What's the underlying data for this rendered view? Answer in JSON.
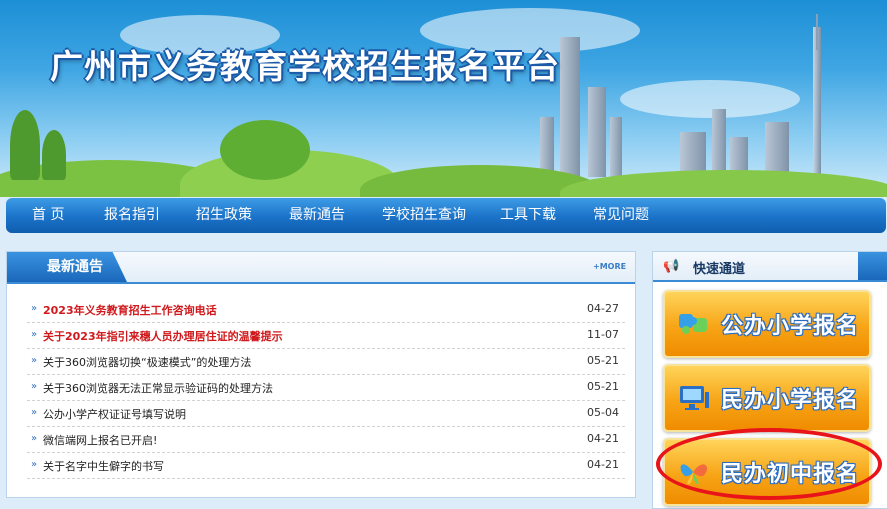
{
  "site": {
    "title": "广州市义务教育学校招生报名平台"
  },
  "nav": [
    {
      "label": "首 页"
    },
    {
      "label": "报名指引"
    },
    {
      "label": "招生政策"
    },
    {
      "label": "最新通告"
    },
    {
      "label": "学校招生查询"
    },
    {
      "label": "工具下载"
    },
    {
      "label": "常见问题"
    }
  ],
  "notices": {
    "title": "最新通告",
    "more": "+MORE",
    "items": [
      {
        "title": "2023年义务教育招生工作咨询电话",
        "date": "04-27",
        "highlight": true
      },
      {
        "title": "关于2023年指引来穗人员办理居住证的温馨提示",
        "date": "11-07",
        "highlight": true
      },
      {
        "title": "关于360浏览器切换“极速模式”的处理方法",
        "date": "05-21",
        "highlight": false
      },
      {
        "title": "关于360浏览器无法正常显示验证码的处理方法",
        "date": "05-21",
        "highlight": false
      },
      {
        "title": "公办小学产权证证号填写说明",
        "date": "05-04",
        "highlight": false
      },
      {
        "title": "微信端网上报名已开启!",
        "date": "04-21",
        "highlight": false
      },
      {
        "title": "关于名字中生僻字的书写",
        "date": "04-21",
        "highlight": false
      }
    ]
  },
  "quick": {
    "title": "快速通道",
    "buttons": [
      {
        "label": "公办小学报名",
        "icon": "puzzle-icon"
      },
      {
        "label": "民办小学报名",
        "icon": "computer-icon"
      },
      {
        "label": "民办初中报名",
        "icon": "butterfly-icon"
      }
    ]
  },
  "colors": {
    "nav": "#1b72c8",
    "hot": "#d0191c",
    "button": "#f7a416",
    "annotation": "#e8141a"
  }
}
